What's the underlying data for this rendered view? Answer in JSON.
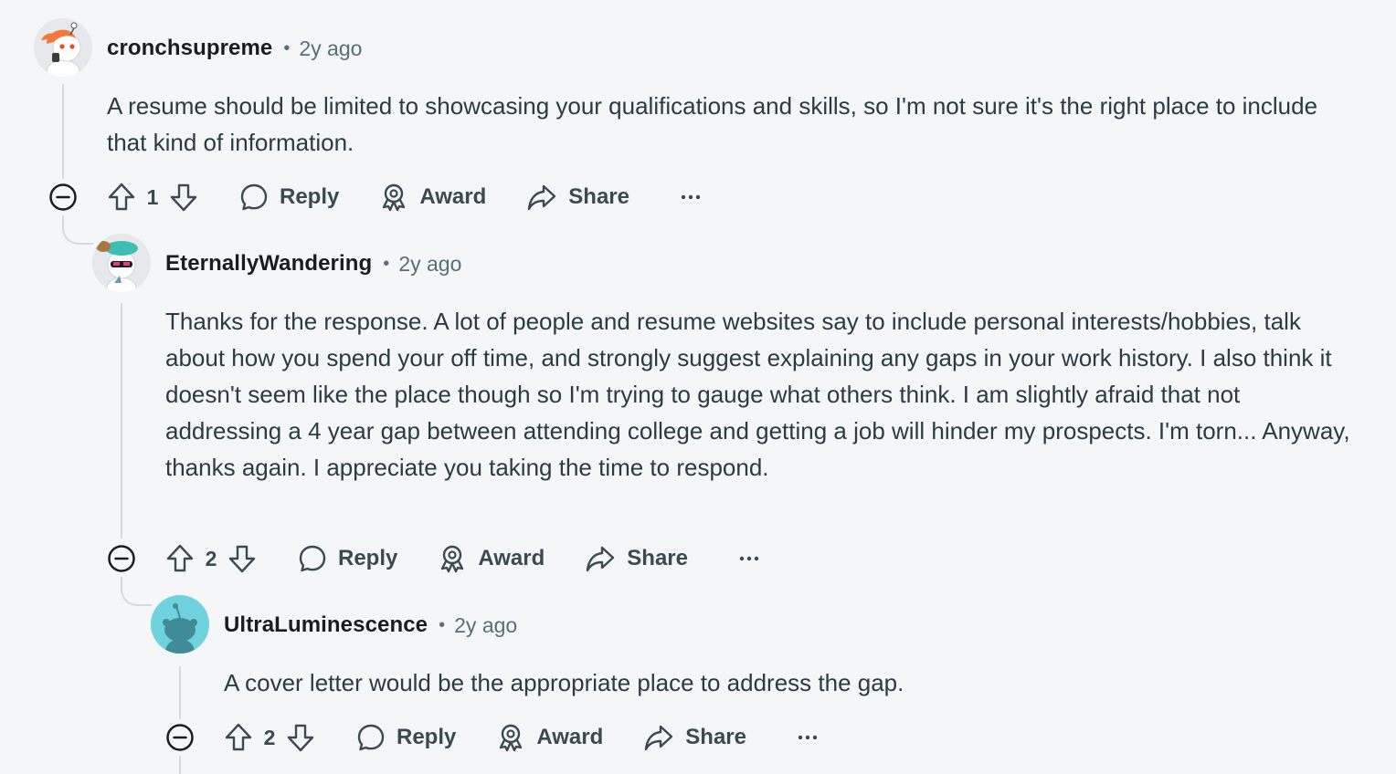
{
  "comments": [
    {
      "author": "cronchsupreme",
      "time": "2y ago",
      "body": "A resume should be limited to showcasing your qualifications and skills, so I'm not sure it's the right place to include that kind of information.",
      "votes": "1",
      "avatar_icon": "snoo-avatar-orange-hair",
      "avatar_color": "#e8e9ec"
    },
    {
      "author": "EternallyWandering",
      "time": "2y ago",
      "body": "Thanks for the response. A lot of people and resume websites say to include personal interests/hobbies, talk about how you spend your off time, and strongly suggest explaining any gaps in your work history. I also think it doesn't seem like the place though so I'm trying to gauge what others think. I am slightly afraid that not addressing a 4 year gap between attending college and getting a job will hinder my prospects. I'm torn... Anyway, thanks again. I appreciate you taking the time to respond.",
      "votes": "2",
      "avatar_icon": "snoo-avatar-sunglasses",
      "avatar_color": "#e8e9ec"
    },
    {
      "author": "UltraLuminescence",
      "time": "2y ago",
      "body": "A cover letter would be the appropriate place to address the gap.",
      "votes": "2",
      "avatar_icon": "snoo-default-avatar",
      "avatar_color": "#6fd3df"
    }
  ],
  "actions": {
    "reply": "Reply",
    "award": "Award",
    "share": "Share",
    "more": "···"
  },
  "colors": {
    "background": "#f5f6f8",
    "text": "#2a3c42",
    "meta": "#576f76",
    "thread_line": "#d5d8de"
  }
}
